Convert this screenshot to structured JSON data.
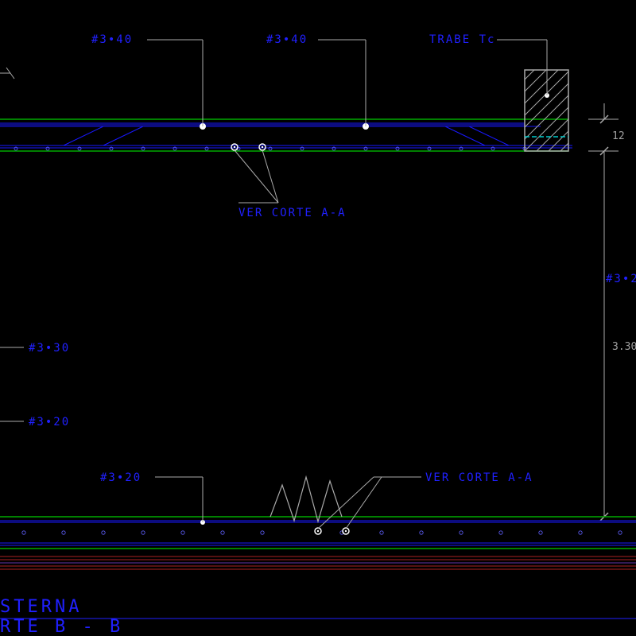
{
  "labels": {
    "top_left_rebar": "#3•40",
    "top_right_rebar": "#3•40",
    "trabe": "TRABE Tc",
    "ver_corte_aa_upper": "VER CORTE A-A",
    "ver_corte_aa_lower": "VER CORTE A-A",
    "rebar_3_30": "#3•30",
    "rebar_3_20_left": "#3•20",
    "rebar_3_20_bottom": "#3•20",
    "rebar_3_2_right": "#3•2",
    "title_line1": "STERNA",
    "title_line2": "RTE B - B"
  },
  "dimensions": {
    "slab_thickness": "12",
    "height": "3.30"
  }
}
